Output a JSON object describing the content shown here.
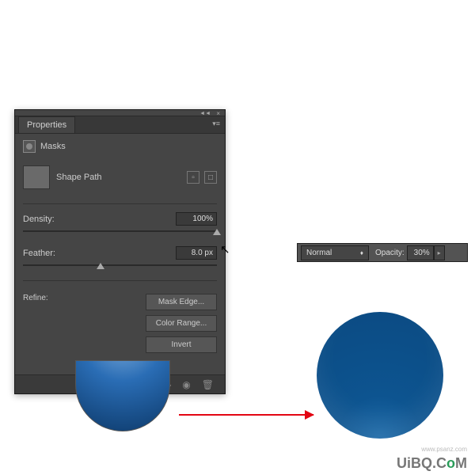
{
  "panel": {
    "tab": "Properties",
    "section_title": "Masks",
    "shape_label": "Shape Path",
    "density": {
      "label": "Density:",
      "value": "100%",
      "pos": 100
    },
    "feather": {
      "label": "Feather:",
      "value": "8.0 px",
      "pos": 38
    },
    "refine": {
      "label": "Refine:",
      "buttons": {
        "mask_edge": "Mask Edge...",
        "color_range": "Color Range...",
        "invert": "Invert"
      }
    }
  },
  "options_bar": {
    "blend_mode": "Normal",
    "opacity_label": "Opacity:",
    "opacity_value": "30%"
  },
  "watermark": {
    "text": "UiBQ.CoM",
    "sub": "www.psanz.com"
  }
}
